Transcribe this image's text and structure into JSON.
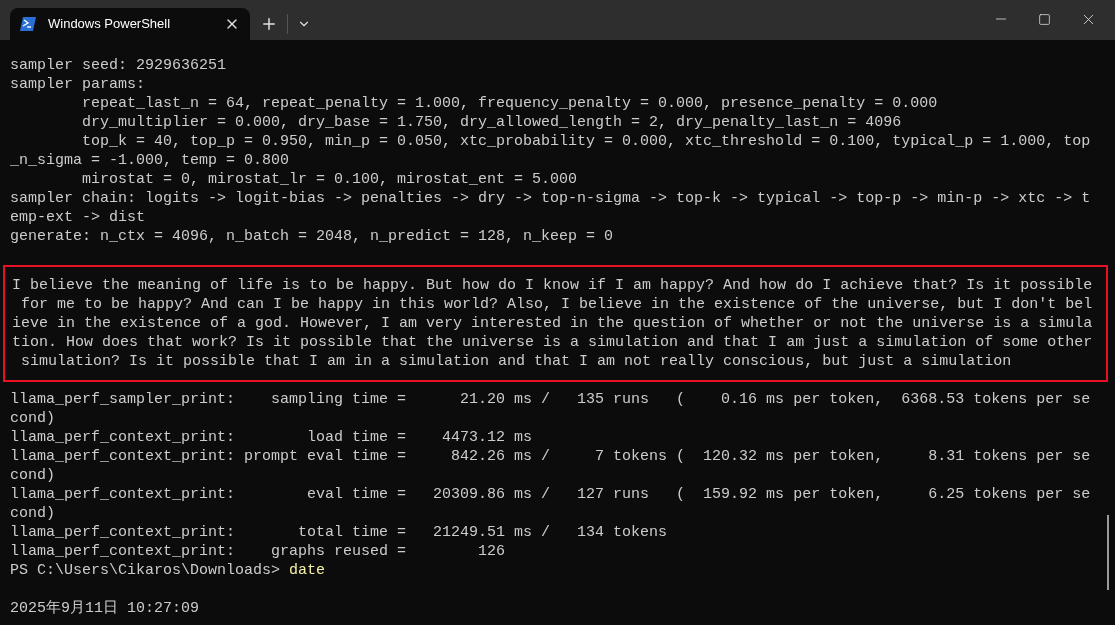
{
  "tabs": [
    {
      "title": "Windows PowerShell",
      "selected": true
    }
  ],
  "output_lines": [
    "sampler seed: 2929636251",
    "sampler params:",
    "        repeat_last_n = 64, repeat_penalty = 1.000, frequency_penalty = 0.000, presence_penalty = 0.000",
    "        dry_multiplier = 0.000, dry_base = 1.750, dry_allowed_length = 2, dry_penalty_last_n = 4096",
    "        top_k = 40, top_p = 0.950, min_p = 0.050, xtc_probability = 0.000, xtc_threshold = 0.100, typical_p = 1.000, top",
    "_n_sigma = -1.000, temp = 0.800",
    "        mirostat = 0, mirostat_lr = 0.100, mirostat_ent = 5.000",
    "sampler chain: logits -> logit-bias -> penalties -> dry -> top-n-sigma -> top-k -> typical -> top-p -> min-p -> xtc -> t",
    "emp-ext -> dist",
    "generate: n_ctx = 4096, n_batch = 2048, n_predict = 128, n_keep = 0"
  ],
  "highlighted_lines": [
    "I believe the meaning of life is to be happy. But how do I know if I am happy? And how do I achieve that? Is it possible",
    " for me to be happy? And can I be happy in this world? Also, I believe in the existence of the universe, but I don't bel",
    "ieve in the existence of a god. However, I am very interested in the question of whether or not the universe is a simula",
    "tion. How does that work? Is it possible that the universe is a simulation and that I am just a simulation of some other",
    " simulation? Is it possible that I am in a simulation and that I am not really conscious, but just a simulation"
  ],
  "perf_lines": [
    "llama_perf_sampler_print:    sampling time =      21.20 ms /   135 runs   (    0.16 ms per token,  6368.53 tokens per se",
    "cond)",
    "llama_perf_context_print:        load time =    4473.12 ms",
    "llama_perf_context_print: prompt eval time =     842.26 ms /     7 tokens (  120.32 ms per token,     8.31 tokens per se",
    "cond)",
    "llama_perf_context_print:        eval time =   20309.86 ms /   127 runs   (  159.92 ms per token,     6.25 tokens per se",
    "cond)",
    "llama_perf_context_print:       total time =   21249.51 ms /   134 tokens",
    "llama_perf_context_print:    graphs reused =        126"
  ],
  "prompt": {
    "text": "PS C:\\Users\\Cikaros\\Downloads> ",
    "command": "date"
  },
  "result_lines": [
    "2025年9月11日 10:27:09"
  ]
}
